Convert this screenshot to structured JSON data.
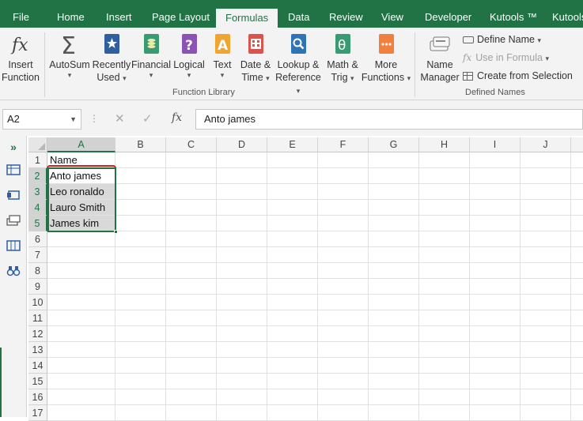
{
  "tabs": [
    "File",
    "Home",
    "Insert",
    "Page Layout",
    "Formulas",
    "Data",
    "Review",
    "View",
    "Developer",
    "Kutools ™",
    "Kutools"
  ],
  "active_tab": "Formulas",
  "ribbon": {
    "insert_function": [
      "Insert",
      "Function"
    ],
    "autosum": "AutoSum",
    "recently_used": [
      "Recently",
      "Used"
    ],
    "financial": "Financial",
    "logical": "Logical",
    "text": "Text",
    "date_time": [
      "Date &",
      "Time"
    ],
    "lookup_reference": [
      "Lookup &",
      "Reference"
    ],
    "math_trig": [
      "Math &",
      "Trig"
    ],
    "more_functions": [
      "More",
      "Functions"
    ],
    "group_function_library": "Function Library",
    "name_manager": [
      "Name",
      "Manager"
    ],
    "define_name": "Define Name",
    "use_in_formula": "Use in Formula",
    "create_from_selection": "Create from Selection",
    "group_defined_names": "Defined Names"
  },
  "formula_bar": {
    "name_box": "A2",
    "fx_label": "fx",
    "content": "Anto james"
  },
  "grid": {
    "columns": [
      "A",
      "B",
      "C",
      "D",
      "E",
      "F",
      "G",
      "H",
      "I",
      "J"
    ],
    "rows": [
      "1",
      "2",
      "3",
      "4",
      "5",
      "6",
      "7",
      "8",
      "9",
      "10",
      "11",
      "12",
      "13",
      "14",
      "15",
      "16",
      "17"
    ],
    "cells": {
      "A1": "Name",
      "A2": "Anto james",
      "A3": "Leo ronaldo",
      "A4": "Lauro Smith",
      "A5": "James kim"
    }
  },
  "colors": {
    "accent": "#217346",
    "highlight_box": "#e8141c"
  }
}
